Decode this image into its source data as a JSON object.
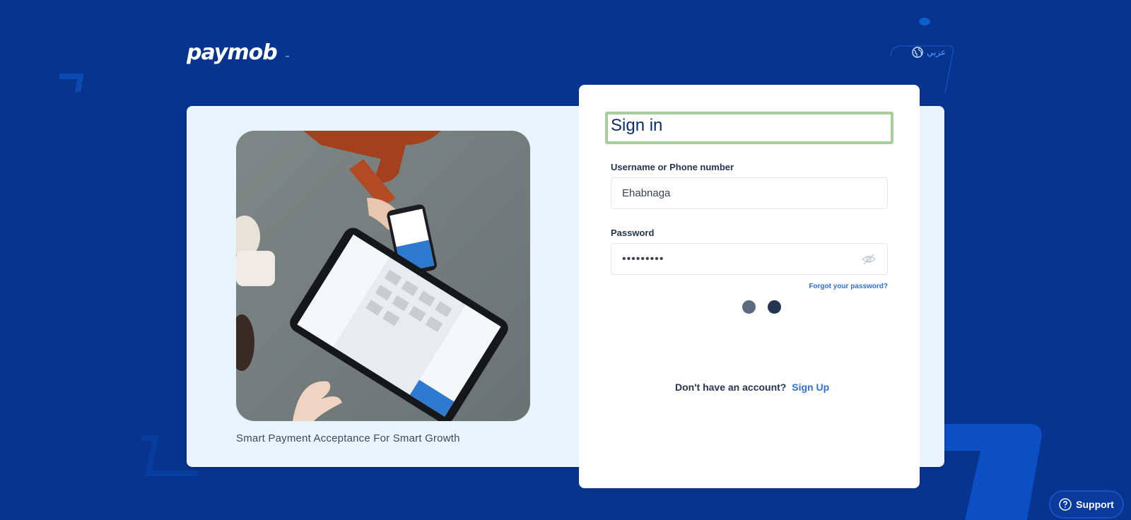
{
  "brand": {
    "logo_text": "paymob"
  },
  "language_toggle": {
    "label": "عربي"
  },
  "info_panel": {
    "tagline": "Smart Payment Acceptance For Smart Growth"
  },
  "signin": {
    "title": "Sign in",
    "username": {
      "label": "Username or Phone number",
      "value": "Ehabnaga"
    },
    "password": {
      "label": "Password",
      "value": "•••••••••"
    },
    "forgot_label": "Forgot your password?",
    "signup_prompt": "Don't have an account?",
    "signup_link": "Sign Up"
  },
  "support": {
    "label": "Support"
  },
  "colors": {
    "background": "#06348f",
    "accent": "#2f6fd6",
    "panel": "#e8f3fd"
  }
}
